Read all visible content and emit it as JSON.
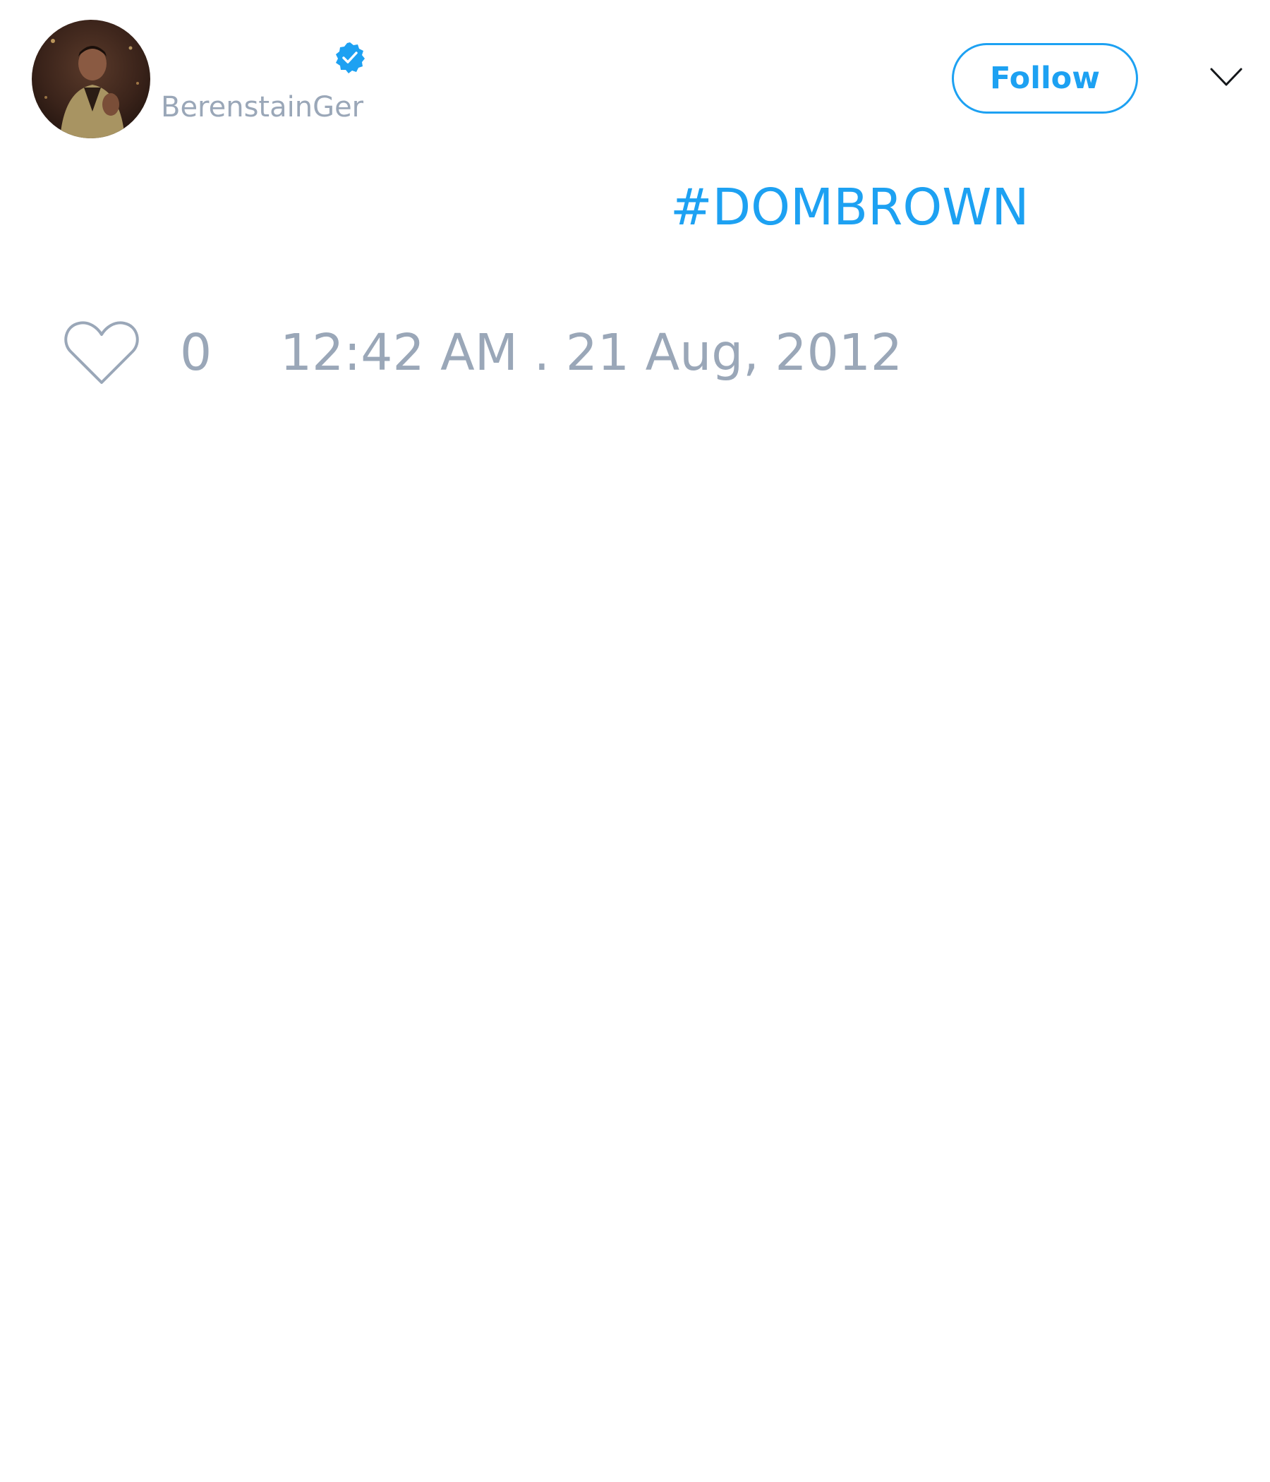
{
  "tweet": {
    "author": {
      "handle": "BerenstainGer",
      "avatar_icon": "profile-photo",
      "verified": true,
      "verified_icon": "verified-badge-icon"
    },
    "follow_label": "Follow",
    "menu_icon": "chevron-down-icon",
    "text": "#DOMBROWN",
    "likes": "0",
    "like_icon": "heart-outline-icon",
    "timestamp": "12:42 AM . 21 Aug, 2012"
  },
  "colors": {
    "accent": "#1da1f2",
    "muted_text": "#9aa7b8",
    "background": "#ffffff"
  }
}
